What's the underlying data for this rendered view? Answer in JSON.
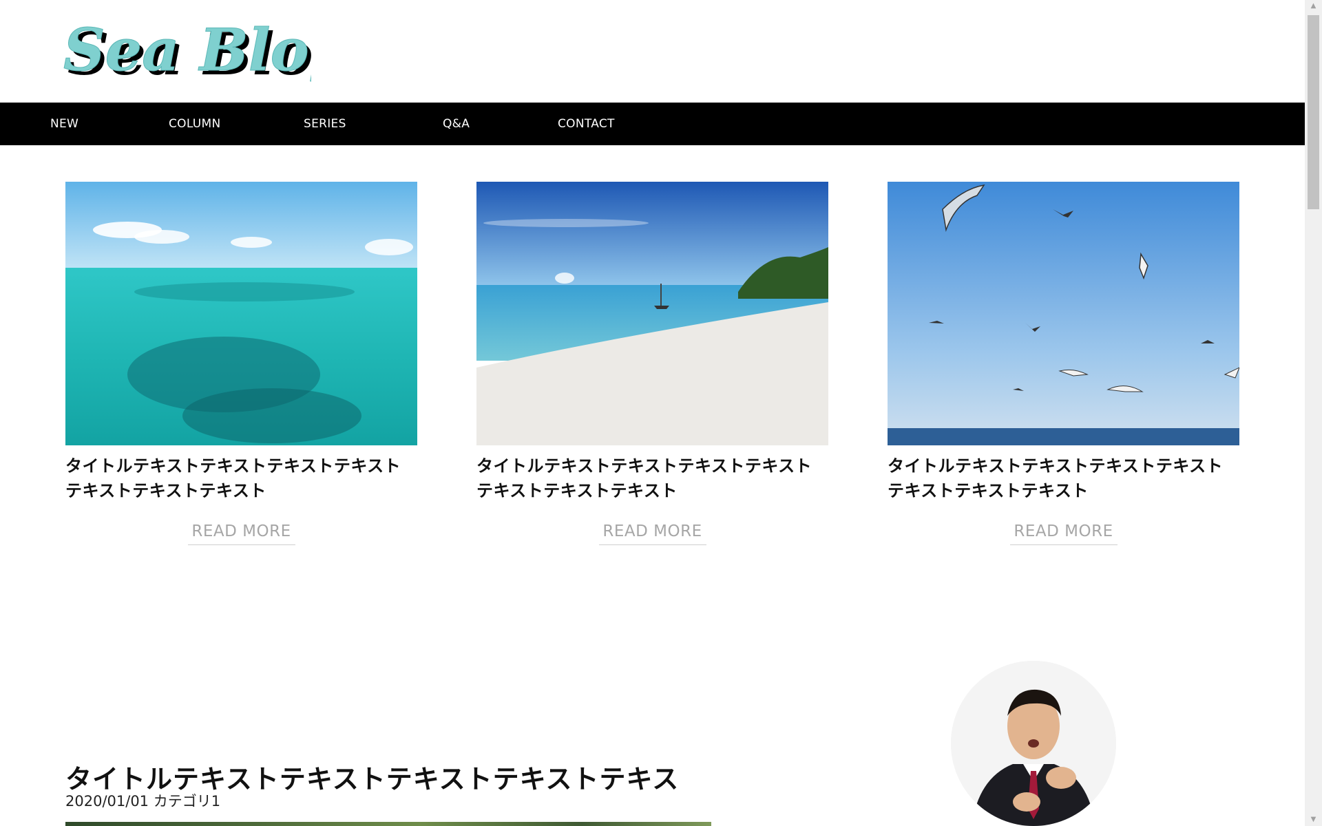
{
  "site": {
    "logo_text": "Sea Blog"
  },
  "nav": {
    "items": [
      {
        "label": "NEW"
      },
      {
        "label": "COLUMN"
      },
      {
        "label": "SERIES"
      },
      {
        "label": "Q&A"
      },
      {
        "label": "CONTACT"
      }
    ]
  },
  "cards": [
    {
      "image": "turquoise-sea-photo",
      "title": "タイトルテキストテキストテキストテキストテキストテキストテキスト",
      "read_more": "READ MORE"
    },
    {
      "image": "white-beach-island-photo",
      "title": "タイトルテキストテキストテキストテキストテキストテキストテキスト",
      "read_more": "READ MORE"
    },
    {
      "image": "seagulls-sky-photo",
      "title": "タイトルテキストテキストテキストテキストテキストテキストテキスト",
      "read_more": "READ MORE"
    }
  ],
  "post": {
    "title": "タイトルテキストテキストテキストテキストテキス",
    "date": "2020/01/01",
    "category": "カテゴリ1",
    "author_image": "businessman-portrait-photo"
  },
  "colors": {
    "nav_bg": "#000000",
    "logo_fill": "#7fd0cf",
    "read_more": "#a6a6a6"
  }
}
